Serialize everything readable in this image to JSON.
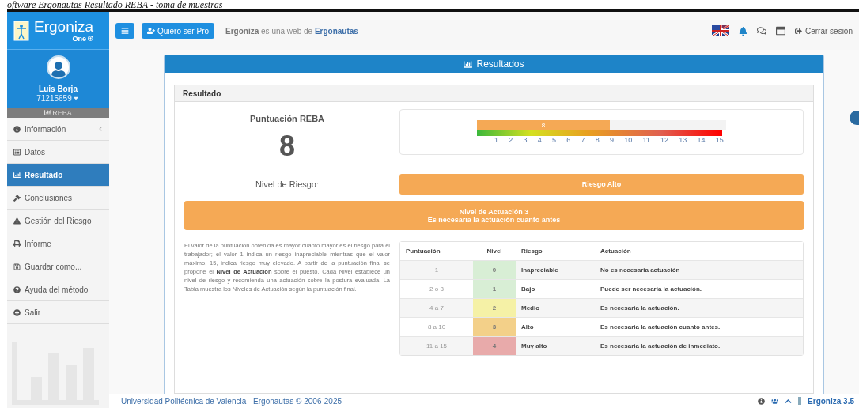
{
  "caption": "oftware Ergonautas Resultado REBA - toma de muestras",
  "topbar": {
    "logo": {
      "name": "Ergoniza",
      "sub": "One"
    },
    "pro_button": "Quiero ser Pro",
    "tagline": "**Ergoniza** es una web de **Ergonautas**",
    "logout": "Cerrar sesión"
  },
  "sidebar": {
    "user": {
      "name": "Luis Borja",
      "id": "71215659"
    },
    "section": "REBA",
    "items": [
      {
        "label": "Información",
        "selected": false,
        "expandable": true
      },
      {
        "label": "Datos",
        "selected": false,
        "expandable": false
      },
      {
        "label": "Resultado",
        "selected": true,
        "expandable": false
      },
      {
        "label": "Conclusiones",
        "selected": false,
        "expandable": false
      },
      {
        "label": "Gestión del Riesgo",
        "selected": false,
        "expandable": false
      },
      {
        "label": "Informe",
        "selected": false,
        "expandable": false
      },
      {
        "label": "Guardar como...",
        "selected": false,
        "expandable": false
      },
      {
        "label": "Ayuda del método",
        "selected": false,
        "expandable": false
      },
      {
        "label": "Salir",
        "selected": false,
        "expandable": false
      }
    ]
  },
  "panel": {
    "title": "Resultados",
    "section": "Resultado",
    "score_label": "Puntuación REBA",
    "score": "8",
    "gauge": {
      "value_label": "8",
      "level": 0.533,
      "scale": [
        "1",
        "2",
        "3",
        "4",
        "5",
        "6",
        "7",
        "8",
        "9",
        "10",
        "11",
        "12",
        "13",
        "14",
        "15"
      ]
    },
    "risk_label": "Nivel de Riesgo:",
    "risk_value": "Riesgo Alto",
    "action_lines": [
      "Nivel de Actuación 3",
      "Es necesaria la actuación cuanto antes"
    ],
    "description": "El valor de la puntuación obtenida es mayor cuanto mayor es el riesgo para el trabajador; el valor 1 indica un riesgo inapreciable mientras que el valor máximo, 15, indica riesgo muy elevado. A partir de la puntuación final se propone el **Nivel de Actuación** sobre el puesto. Cada Nivel establece un nivel de riesgo y recomienda una actuación sobre la postura evaluada. La Tabla muestra los Niveles de Actuación según la puntuación final.",
    "table": {
      "columns": [
        "Puntuación",
        "Nivel",
        "Riesgo",
        "Actuación"
      ],
      "rows": [
        {
          "score": "1",
          "level": "0",
          "risk": "Inapreciable",
          "action": "No es necesaria actuación",
          "color": "#d8eed5"
        },
        {
          "score": "2 o 3",
          "level": "1",
          "risk": "Bajo",
          "action": "Puede ser necesaria la actuación.",
          "color": "#d8eed5"
        },
        {
          "score": "4 a 7",
          "level": "2",
          "risk": "Medio",
          "action": "Es necesaria la actuación.",
          "color": "#f5f1a6"
        },
        {
          "score": "8 a 10",
          "level": "3",
          "risk": "Alto",
          "action": "Es necesaria la actuación cuanto antes.",
          "color": "#f3d089"
        },
        {
          "score": "11 a 15",
          "level": "4",
          "risk": "Muy alto",
          "action": "Es necesaria la actuación de inmediato.",
          "color": "#e8aaaa"
        }
      ]
    }
  },
  "footer": {
    "text": "Universidad Politécnica de Valencia - Ergonautas © 2006-2025",
    "version": "Ergoniza 3.5"
  }
}
